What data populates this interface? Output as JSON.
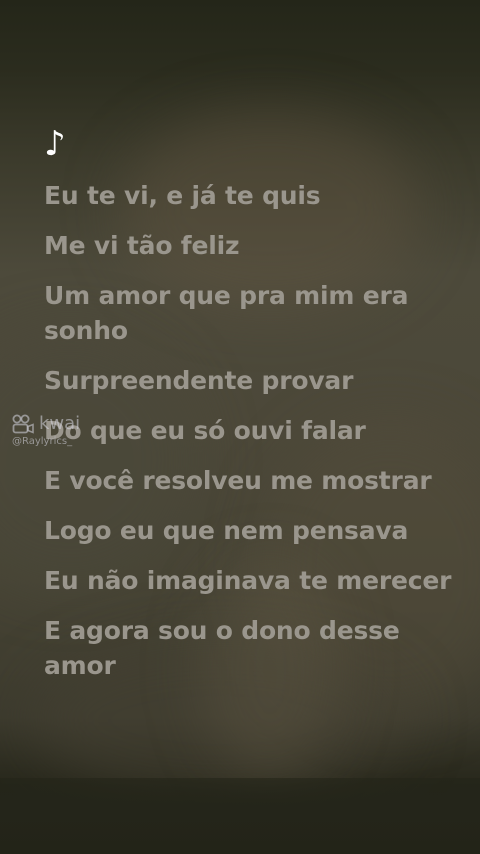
{
  "icons": {
    "music_note": "♪",
    "watermark_logo": "kwai-logo-icon"
  },
  "watermark": {
    "brand": "kwai",
    "handle": "@Raylyrics_"
  },
  "lyrics": [
    "Eu te vi, e já te quis",
    "Me vi tão feliz",
    "Um amor que pra mim era sonho",
    "Surpreendente provar",
    "Do que eu só ouvi falar",
    "E você resolveu me mostrar",
    "Logo eu que nem pensava",
    "Eu não imaginava te merecer",
    "E agora sou o dono desse amor"
  ],
  "colors": {
    "lyric_text": "#9a968d",
    "note": "#ffffff",
    "background": "#4b4838"
  }
}
